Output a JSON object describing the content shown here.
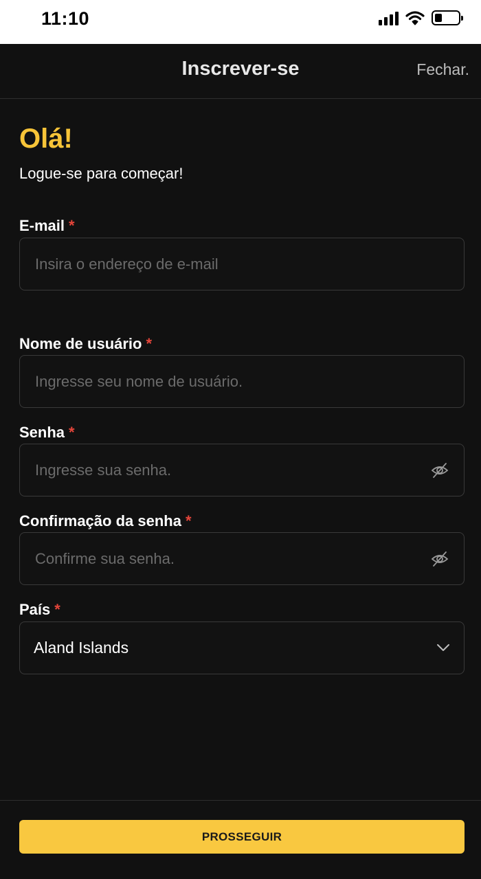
{
  "status_bar": {
    "time": "11:10",
    "battery_level": 0.3
  },
  "header": {
    "title": "Inscrever-se",
    "close_label": "Fechar."
  },
  "greeting": {
    "title": "Olá!",
    "subtitle": "Logue-se para começar!"
  },
  "form": {
    "required_mark": "*",
    "email": {
      "label": "E-mail",
      "placeholder": "Insira o endereço de e-mail",
      "value": ""
    },
    "username": {
      "label": "Nome de usuário",
      "placeholder": "Ingresse seu nome de usuário.",
      "value": ""
    },
    "password": {
      "label": "Senha",
      "placeholder": "Ingresse sua senha.",
      "value": "",
      "icon": "eye-off-icon"
    },
    "password_confirm": {
      "label": "Confirmação da senha",
      "placeholder": "Confirme sua senha.",
      "value": "",
      "icon": "eye-off-icon"
    },
    "country": {
      "label": "País",
      "selected": "Aland Islands",
      "icon": "chevron-down-icon"
    }
  },
  "footer": {
    "continue_label": "PROSSEGUIR"
  },
  "colors": {
    "accent": "#f7c438",
    "button": "#f9c840",
    "required": "#e5453a",
    "background": "#111111"
  }
}
